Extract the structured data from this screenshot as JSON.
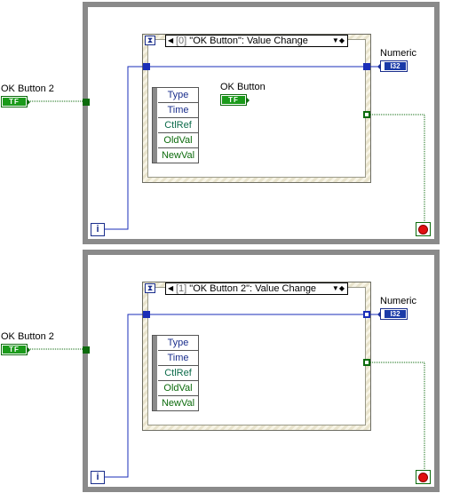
{
  "diagrams": [
    {
      "control_label": "OK Button 2",
      "control_terminal": "TF",
      "event_selector": {
        "index": "[0]",
        "event": "\"OK Button\": Value Change"
      },
      "event_data": [
        "Type",
        "Time",
        "CtlRef",
        "OldVal",
        "NewVal"
      ],
      "inner_terminal_label": "OK Button",
      "inner_terminal": "TF",
      "numeric_label": "Numeric",
      "numeric_terminal": "I32",
      "iteration_label": "i"
    },
    {
      "control_label": "OK Button 2",
      "control_terminal": "TF",
      "event_selector": {
        "index": "[1]",
        "event": "\"OK Button 2\": Value Change"
      },
      "event_data": [
        "Type",
        "Time",
        "CtlRef",
        "OldVal",
        "NewVal"
      ],
      "numeric_label": "Numeric",
      "numeric_terminal": "I32",
      "iteration_label": "i"
    }
  ],
  "colors": {
    "loop_border": "#8a8a8a",
    "boolean_wire": "#0c6b0c",
    "integer_wire": "#1a2eb8",
    "stop_red": "#e01010",
    "event_data_blue": "#1a2e8c",
    "event_data_green": "#0c6b0c"
  }
}
